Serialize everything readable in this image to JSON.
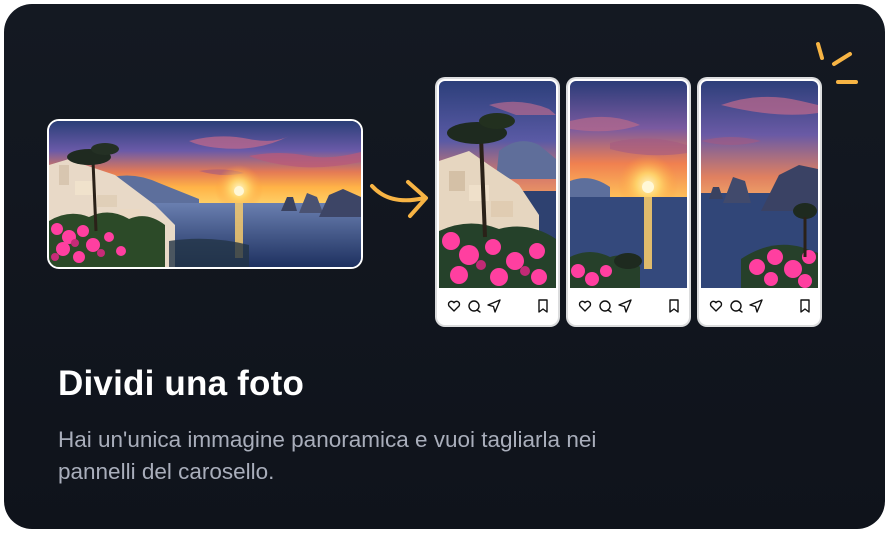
{
  "card": {
    "title": "Dividi una foto",
    "subtitle": "Hai un'unica immagine panoramica e vuoi tagliarla nei pannelli del carosello."
  },
  "illustration": {
    "source_image": "sunset-coast-panorama",
    "arrow_icon": "curved-arrow-right-icon",
    "sparkle_icon": "sparkle-lines-icon",
    "panel_count": 3,
    "panel_actions": [
      "heart-icon",
      "comment-icon",
      "share-icon",
      "bookmark-icon"
    ]
  },
  "colors": {
    "card_background": "#121720",
    "accent": "#f7b444",
    "title": "#ffffff",
    "subtitle": "#a9aebb",
    "panel_background": "#ffffff"
  }
}
